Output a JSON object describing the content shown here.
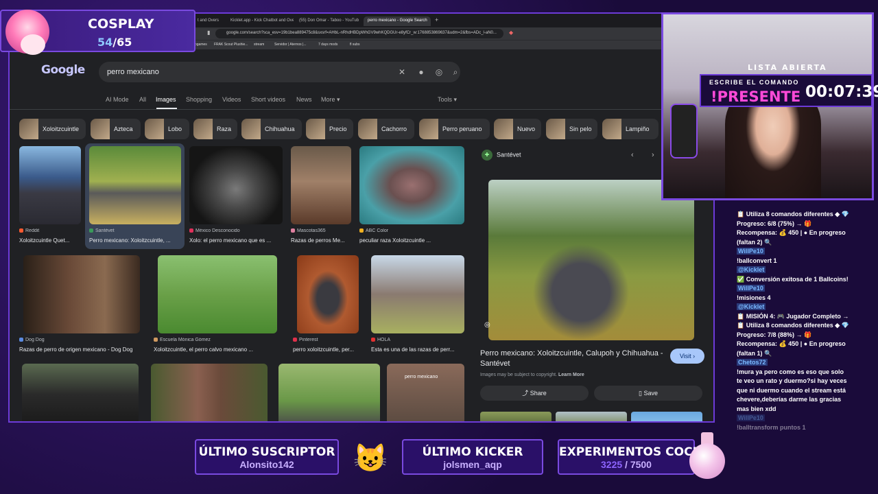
{
  "cosplay": {
    "title": "COSPLAY",
    "current": "54",
    "total": "/65"
  },
  "browser": {
    "tabs": [
      "t and Overs",
      "Kicklet.app - Kick Chatbot and Overl",
      "(55) Don Omar - Taboo - YouTub",
      "perro mexicano - Google Search"
    ],
    "url": "google.com/search?sca_esv=19b1bea889475c8&sxsrf=AHbL-nRhdHBDpWhGV9whKQDGUr-e8yfCr_w:1768853869637&udm=2&fbs=ADc_l-aN0...",
    "bookmarks": [
      "ogames",
      "FRAK Scout Plushie...",
      "stream",
      "Servidor | Aternos |...",
      "7 days mods",
      "fl subs"
    ]
  },
  "google": {
    "logo": "Google",
    "query": "perro mexicano",
    "nav": [
      "AI Mode",
      "All",
      "Images",
      "Shopping",
      "Videos",
      "Short videos",
      "News",
      "More ▾"
    ],
    "tools": "Tools ▾",
    "chips": [
      "Xoloitzcuintle",
      "Azteca",
      "Lobo",
      "Raza",
      "Chihuahua",
      "Precio",
      "Cachorro",
      "Perro peruano",
      "Nuevo",
      "Sin pelo",
      "Lampiño"
    ],
    "results": [
      {
        "source": "Reddit",
        "title": "Xoloitzcuintle Quet...",
        "color": "#ff5a30"
      },
      {
        "source": "Santévet",
        "title": "Perro mexicano: Xoloitzcuintle, ...",
        "color": "#3a9a5a"
      },
      {
        "source": "México Desconocido",
        "title": "Xolo: el perro mexicano que es ...",
        "color": "#e0305a"
      },
      {
        "source": "Mascotas365",
        "title": "Razas de perros Me...",
        "color": "#e080a0"
      },
      {
        "source": "ABC Color",
        "title": "peculiar raza Xoloitzcuintle ...",
        "color": "#f0b020"
      },
      {
        "source": "Dog Dog",
        "title": "Razas de perro de origen mexicano - Dog Dog",
        "color": "#5a8ae0"
      },
      {
        "source": "Escuela Mónica Gómez",
        "title": "Xoloitzcuintle, el perro calvo mexicano ...",
        "color": "#d09a60"
      },
      {
        "source": "Pinterest",
        "title": "perro xoloitzcuintle, per...",
        "color": "#e0304a"
      },
      {
        "source": "HOLA",
        "title": "Esta es una de las razas de perr...",
        "color": "#e03030"
      }
    ],
    "watermark": "perro mexicano"
  },
  "panel": {
    "source": "Santévet",
    "title": "Perro mexicano: Xoloitzcuintle, Calupoh y Chihuahua - Santévet",
    "visit": "Visit ›",
    "copyright": "Images may be subject to copyright.",
    "learn_more": "Learn More",
    "share": "Share",
    "save": "Save"
  },
  "stream": {
    "lista": "LISTA ABIERTA",
    "escribe": "ESCRIBE EL COMANDO",
    "comando": "!PRESENTE",
    "timer": "00:07:39"
  },
  "chat": [
    {
      "t": "📋 Utiliza 8 comandos diferentes ◆ 💎",
      "fade": false
    },
    {
      "t": "Progreso: 6/8 (75%) → 🎁",
      "fade": false
    },
    {
      "t": "Recompensa: 💰 450 | ● En progreso",
      "fade": false
    },
    {
      "t": "(faltan 2) 🔍",
      "fade": false
    },
    {
      "t": "WillPe10",
      "name": true
    },
    {
      "t": "!balIconvert 1",
      "fade": false
    },
    {
      "t": "@Kicklet",
      "name": true
    },
    {
      "t": "✅ Conversión exitosa de 1 BalIcoins!",
      "fade": false
    },
    {
      "t": "WillPe10",
      "name": true
    },
    {
      "t": "!misiones 4",
      "fade": false
    },
    {
      "t": "@Kicklet",
      "name": true
    },
    {
      "t": "📋 MISIÓN 4: 🎮 Jugador Completo →",
      "fade": false
    },
    {
      "t": "📋 Utiliza 8 comandos diferentes ◆ 💎",
      "fade": false
    },
    {
      "t": "Progreso: 7/8 (88%) → 🎁",
      "fade": false
    },
    {
      "t": "Recompensa: 💰 450 | ● En progreso",
      "fade": false
    },
    {
      "t": "(faltan 1) 🔍",
      "fade": false
    },
    {
      "t": "Chetos72",
      "name": true
    },
    {
      "t": "!mura ya pero como es eso que solo",
      "fade": false
    },
    {
      "t": "te veo un rato y duermo?si hay veces",
      "fade": false
    },
    {
      "t": "que ni duermo cuando el stream está",
      "fade": false
    },
    {
      "t": "chevere,deberías darme las gracias",
      "fade": false
    },
    {
      "t": "mas bien xdd",
      "fade": false
    },
    {
      "t": "WillPe10",
      "name": true,
      "fade": true
    },
    {
      "t": "!balItransform puntos 1",
      "fade": true
    }
  ],
  "bottom": {
    "sub_label": "ÚLTIMO SUSCRIPTOR",
    "sub_value": "Alonsito142",
    "kick_label": "ÚLTIMO KICKER",
    "kick_value": "jolsmen_aqp",
    "exp_label": "EXPERIMENTOS COCINA",
    "exp_current": "3225",
    "exp_total": " / 7500"
  },
  "colors": {
    "accent": "#7a4ae0",
    "brand_pink": "#ff4ad8",
    "panel_bg": "#202124"
  }
}
